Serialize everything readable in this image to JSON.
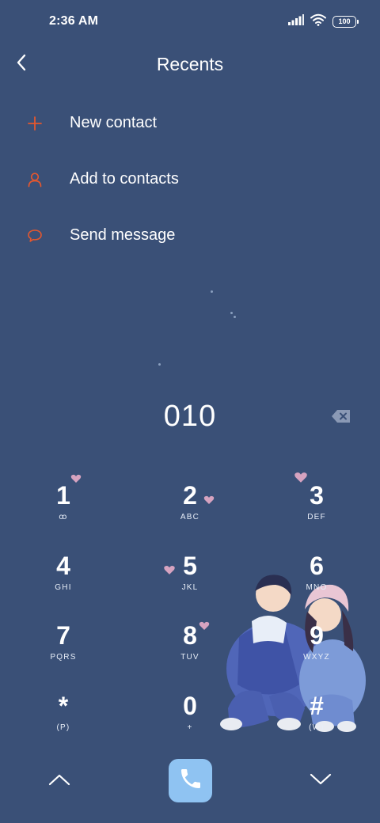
{
  "status_bar": {
    "time": "2:36 AM",
    "battery": "100",
    "icons": [
      "signal-icon",
      "wifi-icon",
      "battery-icon"
    ]
  },
  "header": {
    "title": "Recents",
    "back_icon": "chevron-left-icon"
  },
  "menu": {
    "items": [
      {
        "label": "New contact",
        "icon": "plus-icon"
      },
      {
        "label": "Add to contacts",
        "icon": "person-icon"
      },
      {
        "label": "Send message",
        "icon": "message-bubble-icon"
      }
    ]
  },
  "dialer": {
    "number": "010",
    "delete_icon": "backspace-icon"
  },
  "keypad": {
    "keys": [
      {
        "digit": "1",
        "letters": "ꝏ"
      },
      {
        "digit": "2",
        "letters": "ABC"
      },
      {
        "digit": "3",
        "letters": "DEF"
      },
      {
        "digit": "4",
        "letters": "GHI"
      },
      {
        "digit": "5",
        "letters": "JKL"
      },
      {
        "digit": "6",
        "letters": "MNO"
      },
      {
        "digit": "7",
        "letters": "PQRS"
      },
      {
        "digit": "8",
        "letters": "TUV"
      },
      {
        "digit": "9",
        "letters": "WXYZ"
      },
      {
        "digit": "*",
        "letters": "(P)"
      },
      {
        "digit": "0",
        "letters": "+"
      },
      {
        "digit": "#",
        "letters": "(W)"
      }
    ]
  },
  "bottom_bar": {
    "left_icon": "chevron-up-icon",
    "center_icon": "phone-icon",
    "right_icon": "chevron-down-icon"
  },
  "colors": {
    "background": "#3a5077",
    "accent": "#e4572e",
    "call_button": "#8fc3f2",
    "heart": "#d6a3c0"
  }
}
